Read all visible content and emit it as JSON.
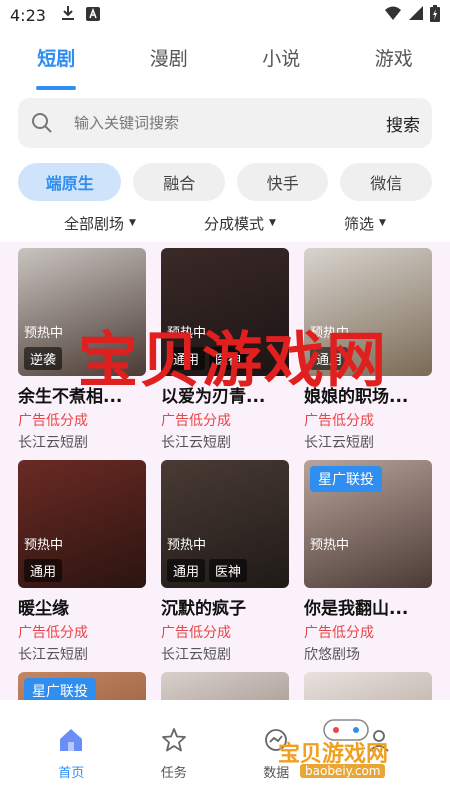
{
  "status_bar": {
    "time": "4:23"
  },
  "top_tabs": [
    {
      "label": "短剧",
      "active": true
    },
    {
      "label": "漫剧",
      "active": false
    },
    {
      "label": "小说",
      "active": false
    },
    {
      "label": "游戏",
      "active": false
    }
  ],
  "search": {
    "placeholder": "输入关键词搜索",
    "button_label": "搜索"
  },
  "chips": [
    {
      "label": "端原生",
      "active": true
    },
    {
      "label": "融合",
      "active": false
    },
    {
      "label": "快手",
      "active": false
    },
    {
      "label": "微信",
      "active": false
    }
  ],
  "dropdowns": [
    "全部剧场",
    "分成模式",
    "筛选"
  ],
  "cards": [
    {
      "title": "余生不煮相...",
      "ad": "广告低分成",
      "source": "长江云短剧",
      "badge": "预热中",
      "tags": [
        "逆袭"
      ],
      "promo": "",
      "poster_colors": [
        "#c9c4c0",
        "#4a3a33"
      ]
    },
    {
      "title": "以爱为刃青...",
      "ad": "广告低分成",
      "source": "长江云短剧",
      "badge": "预热中",
      "tags": [
        "通用",
        "医神"
      ],
      "promo": "",
      "poster_colors": [
        "#3a2a28",
        "#1c1414"
      ]
    },
    {
      "title": "娘娘的职场...",
      "ad": "广告低分成",
      "source": "长江云短剧",
      "badge": "预热中",
      "tags": [
        "通用"
      ],
      "promo": "",
      "poster_colors": [
        "#d8d4ce",
        "#7a6a55"
      ]
    },
    {
      "title": "暖尘缘",
      "ad": "广告低分成",
      "source": "长江云短剧",
      "badge": "预热中",
      "tags": [
        "通用"
      ],
      "promo": "",
      "poster_colors": [
        "#6b2a24",
        "#2b1410"
      ]
    },
    {
      "title": "沉默的疯子",
      "ad": "广告低分成",
      "source": "长江云短剧",
      "badge": "预热中",
      "tags": [
        "通用",
        "医神"
      ],
      "promo": "",
      "poster_colors": [
        "#4a3b34",
        "#1f1a18"
      ]
    },
    {
      "title": "你是我翻山...",
      "ad": "广告低分成",
      "source": "欣悠剧场",
      "badge": "预热中",
      "tags": [],
      "promo": "星广联投",
      "poster_colors": [
        "#b7a49a",
        "#4c3a36"
      ]
    },
    {
      "title": "",
      "ad": "",
      "source": "",
      "badge": "",
      "tags": [],
      "promo": "星广联投",
      "poster_colors": [
        "#c58560",
        "#7a4b30"
      ]
    },
    {
      "title": "",
      "ad": "",
      "source": "",
      "badge": "",
      "tags": [],
      "promo": "",
      "poster_colors": [
        "#d9d0cc",
        "#7b6b61"
      ]
    },
    {
      "title": "",
      "ad": "",
      "source": "",
      "badge": "",
      "tags": [],
      "promo": "",
      "poster_colors": [
        "#e8e1dd",
        "#9c8b80"
      ]
    }
  ],
  "watermark": {
    "text": "宝贝游戏网",
    "logo_text": "宝贝游戏网",
    "logo_url_text": "baobeiy.com"
  },
  "bottom_nav": [
    {
      "label": "首页",
      "icon": "home-icon",
      "active": true
    },
    {
      "label": "任务",
      "icon": "star-icon",
      "active": false
    },
    {
      "label": "数据",
      "icon": "chart-icon",
      "active": false
    },
    {
      "label": "",
      "icon": "user-icon",
      "active": false
    }
  ],
  "colors": {
    "accent": "#2f8ef0",
    "ad_red": "#e94747",
    "content_bg": "#fbf1fb",
    "watermark_red": "#e01f1f"
  }
}
